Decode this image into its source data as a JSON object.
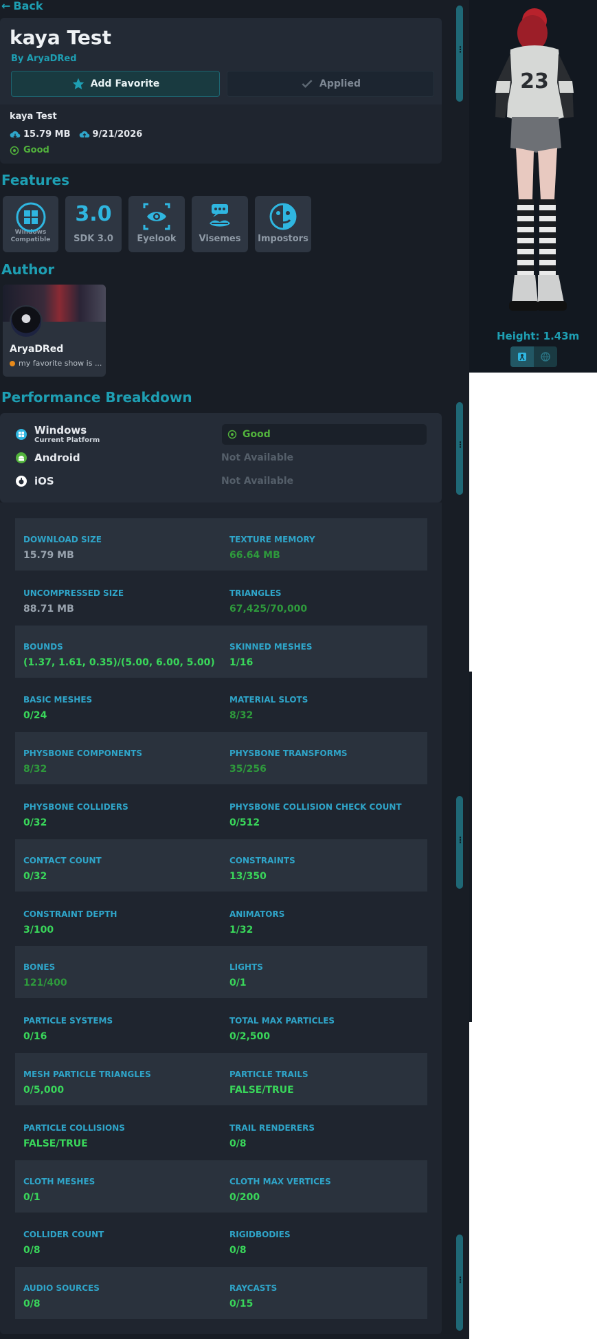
{
  "nav": {
    "back_label": "Back"
  },
  "avatar": {
    "name": "kaya Test",
    "by": "By AryaDRed",
    "add_favorite": "Add Favorite",
    "applied": "Applied",
    "file_name": "kaya Test",
    "size": "15.79 MB",
    "date": "9/21/2026",
    "status": "Good"
  },
  "features": {
    "heading": "Features",
    "items": [
      {
        "label": "Windows Compatible",
        "icon": "windows-icon"
      },
      {
        "label": "SDK 3.0",
        "icon": "sdk-icon",
        "badge": "3.0"
      },
      {
        "label": "Eyelook",
        "icon": "eye-icon"
      },
      {
        "label": "Visemes",
        "icon": "mouth-icon"
      },
      {
        "label": "Impostors",
        "icon": "impostor-icon"
      }
    ]
  },
  "author": {
    "heading": "Author",
    "name": "AryaDRed",
    "status_text": "my favorite show is ...",
    "status_color": "#e88a1a"
  },
  "performance": {
    "heading": "Performance Breakdown",
    "platforms": [
      {
        "name": "Windows",
        "sub": "Current Platform",
        "status": "Good"
      },
      {
        "name": "Android",
        "status": "Not Available"
      },
      {
        "name": "iOS",
        "status": "Not Available"
      }
    ],
    "stats": [
      {
        "left": {
          "k": "DOWNLOAD SIZE",
          "v": "15.79 MB",
          "tone": "gray"
        },
        "right": {
          "k": "TEXTURE MEMORY",
          "v": "66.64 MB",
          "tone": "dim"
        }
      },
      {
        "left": {
          "k": "UNCOMPRESSED SIZE",
          "v": "88.71 MB",
          "tone": "gray"
        },
        "right": {
          "k": "TRIANGLES",
          "v": "67,425/70,000",
          "tone": "dim"
        }
      },
      {
        "left": {
          "k": "BOUNDS",
          "v": "(1.37, 1.61, 0.35)/(5.00, 6.00, 5.00)",
          "tone": "bright"
        },
        "right": {
          "k": "SKINNED MESHES",
          "v": "1/16",
          "tone": "bright"
        }
      },
      {
        "left": {
          "k": "BASIC MESHES",
          "v": "0/24",
          "tone": "bright"
        },
        "right": {
          "k": "MATERIAL SLOTS",
          "v": "8/32",
          "tone": "dim"
        }
      },
      {
        "left": {
          "k": "PHYSBONE COMPONENTS",
          "v": "8/32",
          "tone": "dim"
        },
        "right": {
          "k": "PHYSBONE TRANSFORMS",
          "v": "35/256",
          "tone": "dim"
        }
      },
      {
        "left": {
          "k": "PHYSBONE COLLIDERS",
          "v": "0/32",
          "tone": "bright"
        },
        "right": {
          "k": "PHYSBONE COLLISION CHECK COUNT",
          "v": "0/512",
          "tone": "bright"
        }
      },
      {
        "left": {
          "k": "CONTACT COUNT",
          "v": "0/32",
          "tone": "bright"
        },
        "right": {
          "k": "CONSTRAINTS",
          "v": "13/350",
          "tone": "bright"
        }
      },
      {
        "left": {
          "k": "CONSTRAINT DEPTH",
          "v": "3/100",
          "tone": "bright"
        },
        "right": {
          "k": "ANIMATORS",
          "v": "1/32",
          "tone": "bright"
        }
      },
      {
        "left": {
          "k": "BONES",
          "v": "121/400",
          "tone": "dim"
        },
        "right": {
          "k": "LIGHTS",
          "v": "0/1",
          "tone": "bright"
        }
      },
      {
        "left": {
          "k": "PARTICLE SYSTEMS",
          "v": "0/16",
          "tone": "bright"
        },
        "right": {
          "k": "TOTAL MAX PARTICLES",
          "v": "0/2,500",
          "tone": "bright"
        }
      },
      {
        "left": {
          "k": "MESH PARTICLE TRIANGLES",
          "v": "0/5,000",
          "tone": "bright"
        },
        "right": {
          "k": "PARTICLE TRAILS",
          "v": "FALSE/TRUE",
          "tone": "bright"
        }
      },
      {
        "left": {
          "k": "PARTICLE COLLISIONS",
          "v": "FALSE/TRUE",
          "tone": "bright"
        },
        "right": {
          "k": "TRAIL RENDERERS",
          "v": "0/8",
          "tone": "bright"
        }
      },
      {
        "left": {
          "k": "CLOTH MESHES",
          "v": "0/1",
          "tone": "bright"
        },
        "right": {
          "k": "CLOTH MAX VERTICES",
          "v": "0/200",
          "tone": "bright"
        }
      },
      {
        "left": {
          "k": "COLLIDER COUNT",
          "v": "0/8",
          "tone": "bright"
        },
        "right": {
          "k": "RIGIDBODIES",
          "v": "0/8",
          "tone": "bright"
        }
      },
      {
        "left": {
          "k": "AUDIO SOURCES",
          "v": "0/8",
          "tone": "bright"
        },
        "right": {
          "k": "RAYCASTS",
          "v": "0/15",
          "tone": "bright"
        }
      }
    ]
  },
  "preview": {
    "height_label": "Height: 1.43m",
    "back_number": "23"
  },
  "colors": {
    "accent": "#1e9fb3",
    "good": "#52b33c",
    "stat_bright": "#39d65a",
    "stat_dim": "#2e9a3c"
  }
}
